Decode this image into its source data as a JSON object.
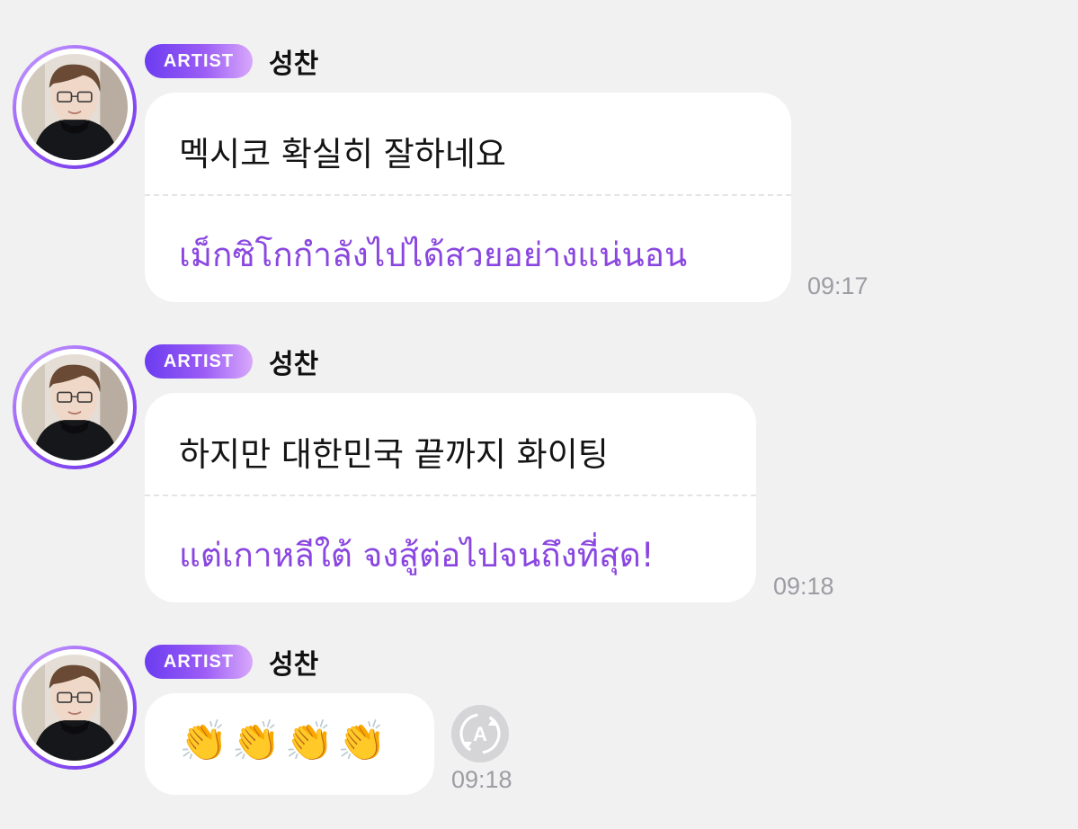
{
  "messages": [
    {
      "badge": "ARTIST",
      "sender": "성찬",
      "original": "멕시코 확실히 잘하네요",
      "translation": "เม็กซิโกกำลังไปได้สวยอย่างแน่นอน",
      "time": "09:17"
    },
    {
      "badge": "ARTIST",
      "sender": "성찬",
      "original": "하지만 대한민국 끝까지 화이팅",
      "translation": "แต่เกาหลีใต้ จงสู้ต่อไปจนถึงที่สุด!",
      "time": "09:18"
    },
    {
      "badge": "ARTIST",
      "sender": "성찬",
      "original": "👏👏👏👏",
      "time": "09:18",
      "translate_icon": "translate-icon"
    }
  ],
  "colors": {
    "background": "#f1f1f2",
    "translation_text": "#8a46e0",
    "badge_start": "#6b3cf0",
    "badge_end": "#d8a8fb"
  }
}
